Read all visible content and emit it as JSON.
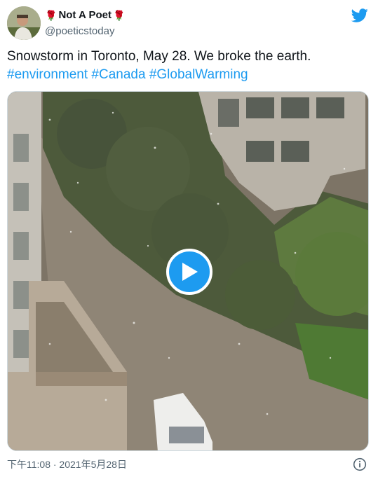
{
  "author": {
    "display_name": "Not A Poet",
    "emoji": "🌹",
    "handle": "@poeticstoday",
    "avatar_icon": "avatar-photo"
  },
  "brand": {
    "icon": "twitter-bird-icon",
    "color": "#1d9bf0"
  },
  "tweet": {
    "text": "Snowstorm in Toronto, May 28. We broke the earth.",
    "hashtags": [
      "#environment",
      "#Canada",
      "#GlobalWarming"
    ]
  },
  "media": {
    "type": "video",
    "play_icon": "play-icon"
  },
  "footer": {
    "timestamp": "下午11:08 · 2021年5月28日",
    "info_icon": "info-icon"
  },
  "colors": {
    "link": "#1d9bf0",
    "secondary_text": "#536471",
    "primary_text": "#0f1419"
  }
}
